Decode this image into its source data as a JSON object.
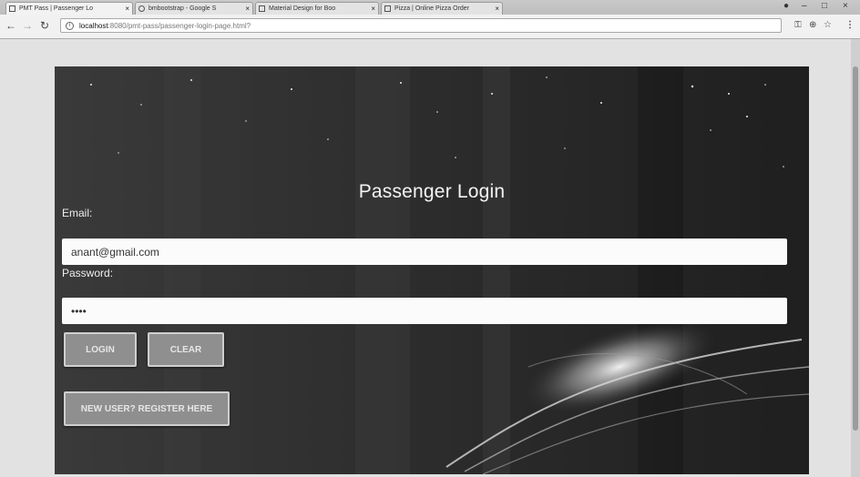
{
  "browser": {
    "tabs": [
      {
        "label": "PMT Pass | Passenger Lo",
        "active": true
      },
      {
        "label": "bmbootstrap - Google S",
        "active": false
      },
      {
        "label": "Material Design for Boo",
        "active": false
      },
      {
        "label": "Pizza | Online Pizza Order",
        "active": false
      }
    ],
    "address": {
      "host": "localhost",
      "path": ":8080/pmt-pass/passenger-login-page.html?"
    }
  },
  "login": {
    "title": "Passenger Login",
    "email_label": "Email:",
    "email_value": "anant@gmail.com",
    "password_label": "Password:",
    "password_value": "••••",
    "login_button": "LOGIN",
    "clear_button": "CLEAR",
    "register_button": "NEW USER?  REGISTER HERE"
  }
}
